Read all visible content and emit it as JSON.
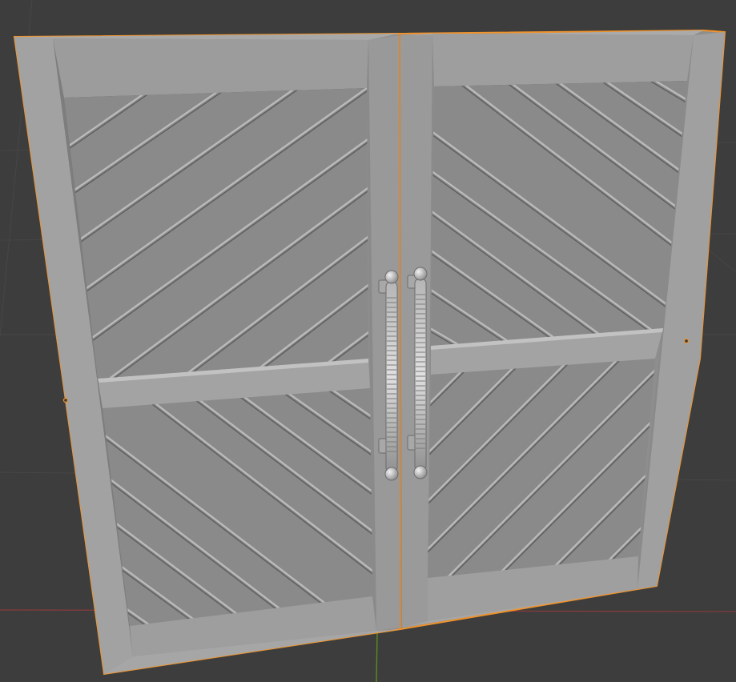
{
  "viewport": {
    "background": "#3d3d3d",
    "grid_line_color": "#464646",
    "x_axis_color": "#8a3a3a",
    "y_axis_color": "#5c8a1e"
  },
  "object": {
    "selection_outline_color": "#f0932b",
    "frame_color": "#9a9a9a",
    "panel_color": "#8d8d8d",
    "handle_color": "#c9c9c9",
    "selected": true
  }
}
